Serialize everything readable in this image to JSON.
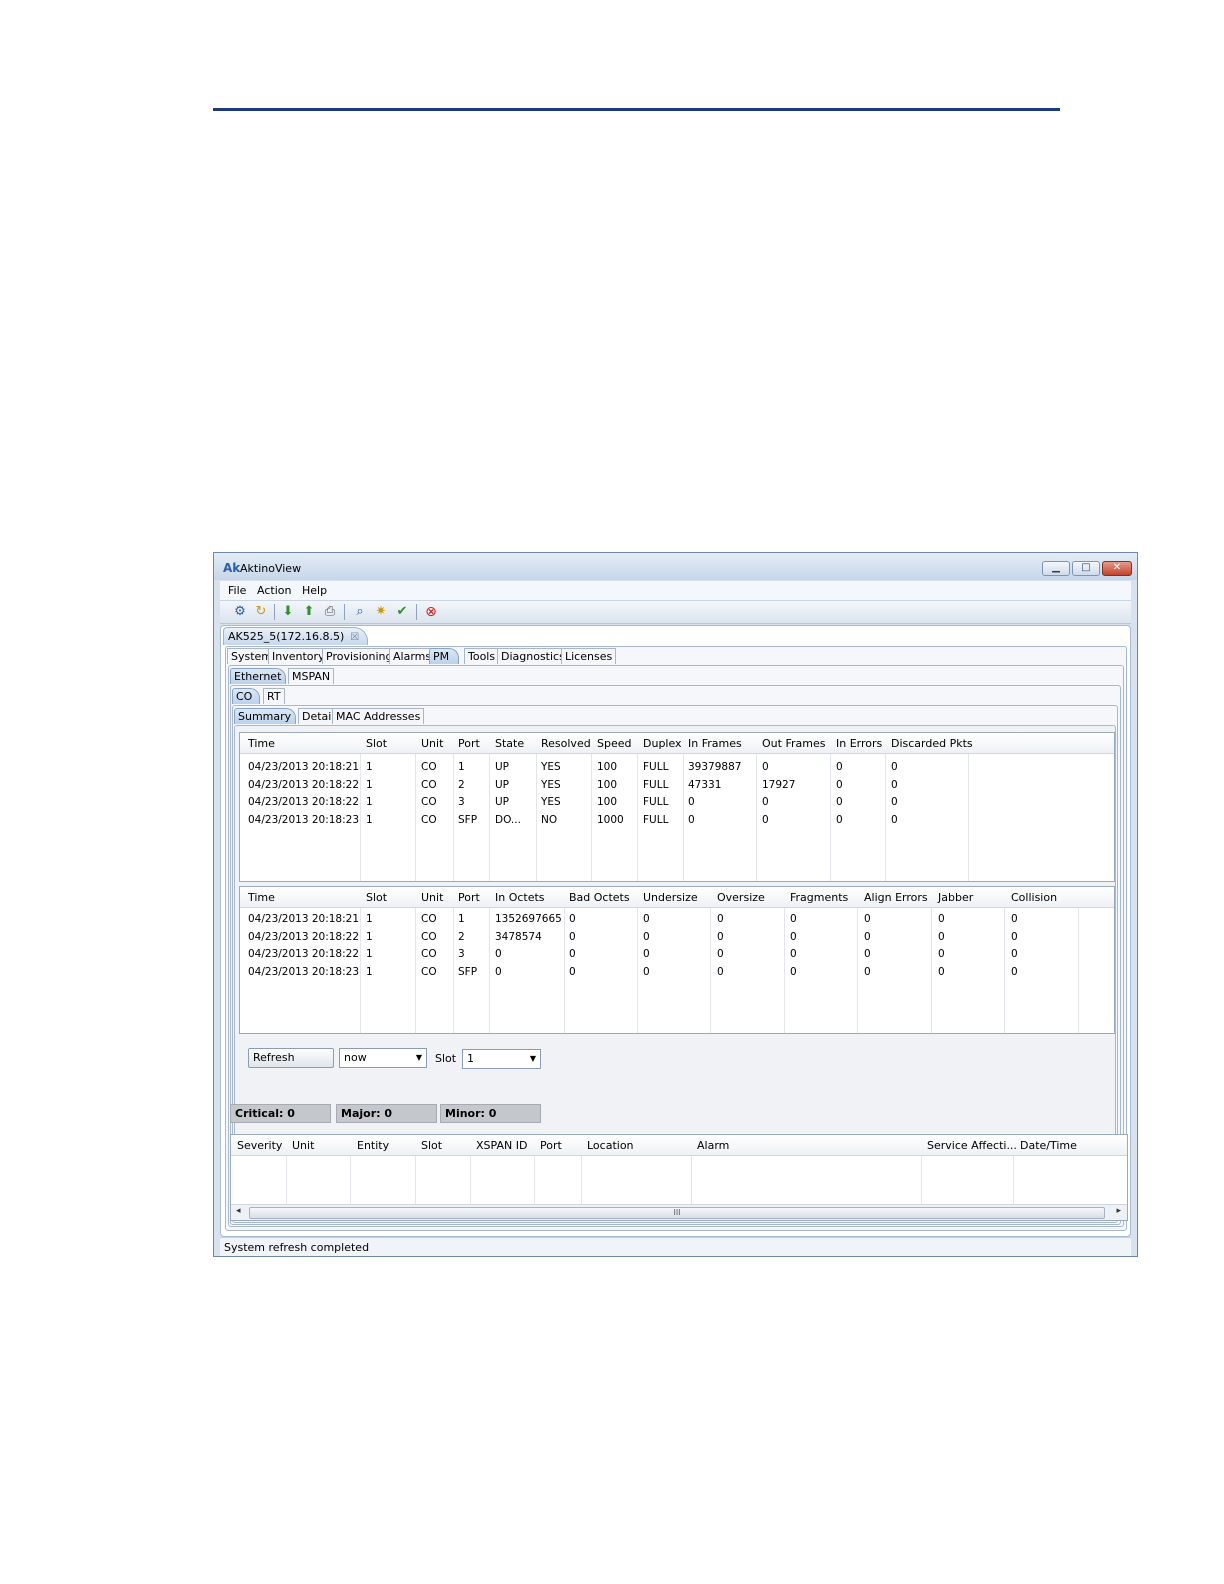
{
  "window": {
    "title": "AktinoView",
    "app_icon": "Ak"
  },
  "menu": [
    "File",
    "Action",
    "Help"
  ],
  "toolbar_icons": [
    "connect-icon",
    "refresh-icon",
    "download-icon",
    "upload-icon",
    "print-icon",
    "find-icon",
    "settings-icon",
    "check-icon",
    "stop-icon"
  ],
  "doc_tab": {
    "label": "AK525_5(172.16.8.5)",
    "close": "☒"
  },
  "main_tabs": [
    "System",
    "Inventory",
    "Provisioning",
    "Alarms",
    "PM",
    "Tools",
    "Diagnostics",
    "Licenses"
  ],
  "sub_tabs": [
    "Ethernet",
    "MSPAN"
  ],
  "side_tabs": [
    "CO",
    "RT"
  ],
  "view_tabs": [
    "Summary",
    "Detail",
    "MAC Addresses"
  ],
  "summary_table": {
    "headers": [
      "Time",
      "Slot",
      "Unit",
      "Port",
      "State",
      "Resolved",
      "Speed",
      "Duplex",
      "In Frames",
      "Out Frames",
      "In Errors",
      "Discarded Pkts"
    ],
    "rows": [
      [
        "04/23/2013 20:18:21",
        "1",
        "CO",
        "1",
        "UP",
        "YES",
        "100",
        "FULL",
        "39379887",
        "0",
        "0",
        "0"
      ],
      [
        "04/23/2013 20:18:22",
        "1",
        "CO",
        "2",
        "UP",
        "YES",
        "100",
        "FULL",
        "47331",
        "17927",
        "0",
        "0"
      ],
      [
        "04/23/2013 20:18:22",
        "1",
        "CO",
        "3",
        "UP",
        "YES",
        "100",
        "FULL",
        "0",
        "0",
        "0",
        "0"
      ],
      [
        "04/23/2013 20:18:23",
        "1",
        "CO",
        "SFP",
        "DO...",
        "NO",
        "1000",
        "FULL",
        "0",
        "0",
        "0",
        "0"
      ]
    ]
  },
  "octets_table": {
    "headers": [
      "Time",
      "Slot",
      "Unit",
      "Port",
      "In Octets",
      "Bad Octets",
      "Undersize",
      "Oversize",
      "Fragments",
      "Align Errors",
      "Jabber",
      "Collision"
    ],
    "rows": [
      [
        "04/23/2013 20:18:21",
        "1",
        "CO",
        "1",
        "1352697665",
        "0",
        "0",
        "0",
        "0",
        "0",
        "0",
        "0"
      ],
      [
        "04/23/2013 20:18:22",
        "1",
        "CO",
        "2",
        "3478574",
        "0",
        "0",
        "0",
        "0",
        "0",
        "0",
        "0"
      ],
      [
        "04/23/2013 20:18:22",
        "1",
        "CO",
        "3",
        "0",
        "0",
        "0",
        "0",
        "0",
        "0",
        "0",
        "0"
      ],
      [
        "04/23/2013 20:18:23",
        "1",
        "CO",
        "SFP",
        "0",
        "0",
        "0",
        "0",
        "0",
        "0",
        "0",
        "0"
      ]
    ]
  },
  "controls": {
    "refresh_label": "Refresh",
    "interval_value": "now",
    "slot_label": "Slot",
    "slot_value": "1"
  },
  "severity": {
    "critical": "Critical: 0",
    "major": "Major: 0",
    "minor": "Minor: 0"
  },
  "alarm_table": {
    "headers": [
      "Severity",
      "Unit",
      "Entity",
      "Slot",
      "XSPAN ID",
      "Port",
      "Location",
      "Alarm",
      "Service Affecti...",
      "Date/Time"
    ],
    "scroll_thumb": "III"
  },
  "status": "System refresh completed",
  "colors": {
    "rule": "#1f3a7a",
    "window_frame": "#d7e2ee",
    "active_tab": "#bcd1ea",
    "severity_bg": "#c4c8cd",
    "close_button": "#c0442c"
  }
}
